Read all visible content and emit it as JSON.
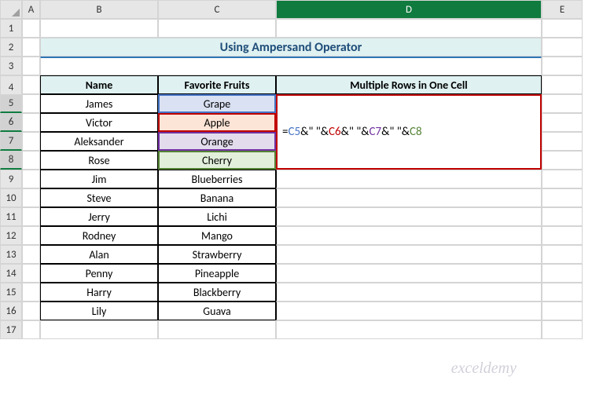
{
  "columns": [
    "A",
    "B",
    "C",
    "D",
    "E"
  ],
  "rows": [
    "1",
    "2",
    "3",
    "4",
    "5",
    "6",
    "7",
    "8",
    "9",
    "10",
    "11",
    "12",
    "13",
    "14",
    "15",
    "16",
    "17"
  ],
  "title": "Using Ampersand Operator",
  "headers": {
    "b4": "Name",
    "c4": "Favorite Fruits",
    "d4": "Multiple Rows in One Cell"
  },
  "names": [
    "James",
    "Victor",
    "Aleksander",
    "Rose",
    "Jim",
    "Steve",
    "Jerry",
    "Rodney",
    "Alan",
    "Penny",
    "Harry",
    "Lily"
  ],
  "fruits": [
    "Grape",
    "Apple",
    "Orange",
    "Cherry",
    "Blueberries",
    "Banana",
    "Lichi",
    "Mango",
    "Strawberry",
    "Pineapple",
    "Blackberry",
    "Guava"
  ],
  "formula": {
    "eq": "=",
    "c5": "C5",
    "amp1": "&\" \"&",
    "c6": "C6",
    "amp2": "&\" \"&",
    "c7": "C7",
    "amp3": "&\" \"&",
    "c8": "C8"
  },
  "watermark": "exceldemy",
  "chart_data": {
    "type": "table",
    "title": "Using Ampersand Operator",
    "columns": [
      "Name",
      "Favorite Fruits",
      "Multiple Rows in One Cell"
    ],
    "rows": [
      [
        "James",
        "Grape",
        "=C5&\" \"&C6&\" \"&C7&\" \"&C8"
      ],
      [
        "Victor",
        "Apple",
        ""
      ],
      [
        "Aleksander",
        "Orange",
        ""
      ],
      [
        "Rose",
        "Cherry",
        ""
      ],
      [
        "Jim",
        "Blueberries",
        ""
      ],
      [
        "Steve",
        "Banana",
        ""
      ],
      [
        "Jerry",
        "Lichi",
        ""
      ],
      [
        "Rodney",
        "Mango",
        ""
      ],
      [
        "Alan",
        "Strawberry",
        ""
      ],
      [
        "Penny",
        "Pineapple",
        ""
      ],
      [
        "Harry",
        "Blackberry",
        ""
      ],
      [
        "Lily",
        "Guava",
        ""
      ]
    ]
  }
}
